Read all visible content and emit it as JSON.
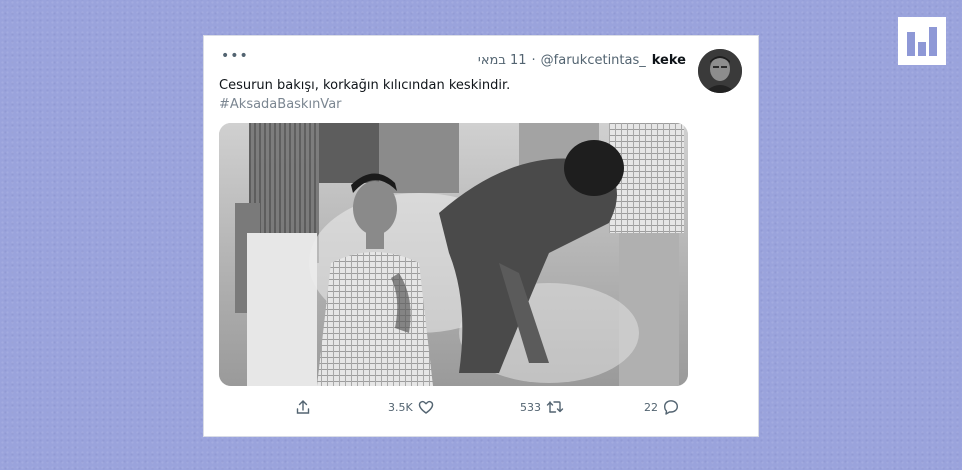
{
  "logo": {
    "icon": "bar-chart-logo-icon"
  },
  "tweet": {
    "display_name": "keke",
    "handle": "@farukcetintas_",
    "separator": "·",
    "date": "11 במאי",
    "text": "Cesurun bakışı, korkağın kılıcından keskindir.",
    "hashtag": "#AksadaBaskınVar",
    "more_icon": "more-icon",
    "photo_description_icon": "photo"
  },
  "actions": {
    "share": {
      "icon": "share-icon"
    },
    "like": {
      "icon": "heart-icon",
      "count": "3.5K"
    },
    "retweet": {
      "icon": "retweet-icon",
      "count": "533"
    },
    "reply": {
      "icon": "reply-icon",
      "count": "22"
    }
  },
  "colors": {
    "background": "#9aa3dc",
    "card": "#ffffff",
    "text": "#0f1419",
    "secondary_text": "#536471",
    "hashtag": "#7b8691"
  }
}
